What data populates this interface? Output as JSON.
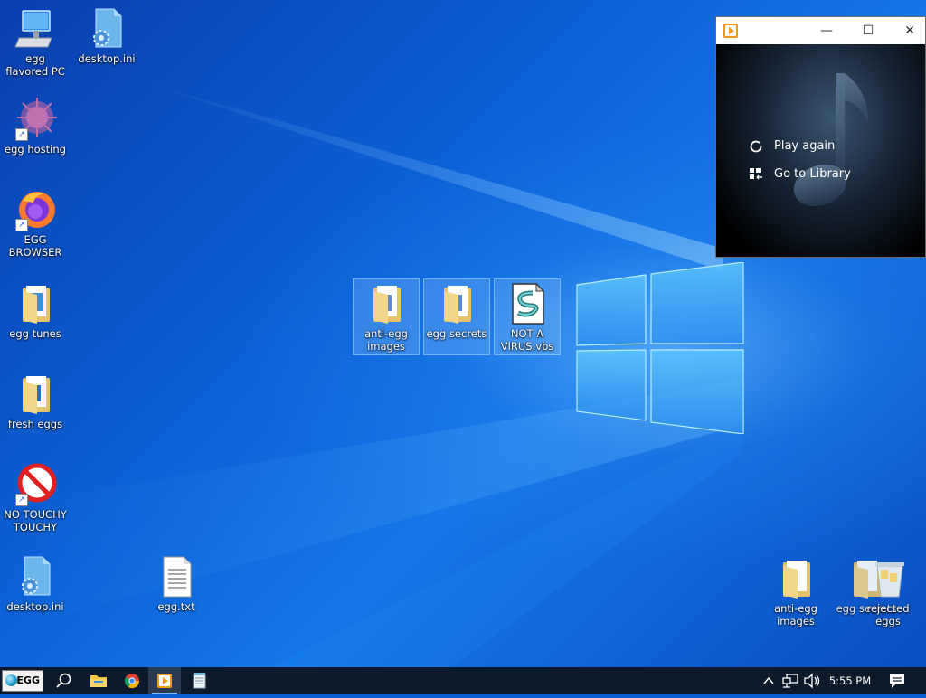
{
  "desktop": {
    "icons_left": [
      {
        "label": "egg flavored PC",
        "icon": "computer-icon"
      },
      {
        "label": "desktop.ini",
        "icon": "settings-file-icon"
      },
      {
        "label": "egg hosting",
        "icon": "globe-network-icon"
      },
      {
        "label": "EGG BROWSER",
        "icon": "firefox-icon"
      },
      {
        "label": "egg tunes",
        "icon": "folder-icon"
      },
      {
        "label": "fresh eggs",
        "icon": "folder-icon"
      },
      {
        "label": "NO TOUCHY TOUCHY",
        "icon": "prohibited-icon"
      },
      {
        "label": "desktop.ini",
        "icon": "settings-file-icon"
      },
      {
        "label": "egg.txt",
        "icon": "text-file-icon"
      }
    ],
    "icons_center_selected": [
      {
        "label": "anti-egg images",
        "icon": "folder-icon"
      },
      {
        "label": "egg secrets",
        "icon": "folder-icon"
      },
      {
        "label": "NOT A VIRUS.vbs",
        "icon": "vbscript-icon"
      }
    ],
    "icons_bottom_right": [
      {
        "label": "anti-egg images",
        "icon": "folder-icon"
      },
      {
        "label": "egg secrets",
        "icon": "folder-icon"
      },
      {
        "label": "rejected eggs",
        "icon": "recycle-bin-icon"
      }
    ]
  },
  "player": {
    "window_title": "",
    "app_icon": "media-player-icon",
    "controls": {
      "minimize": "—",
      "maximize": "☐",
      "close": "✕"
    },
    "menu": [
      {
        "label": "Play again",
        "icon": "replay-icon"
      },
      {
        "label": "Go to Library",
        "icon": "library-icon"
      }
    ]
  },
  "taskbar": {
    "start_label": "EGG",
    "pinned": [
      {
        "name": "search",
        "icon": "search-icon"
      },
      {
        "name": "file-explorer",
        "icon": "folder-icon"
      },
      {
        "name": "chrome",
        "icon": "chrome-icon"
      },
      {
        "name": "media-player",
        "icon": "media-player-icon",
        "active": true
      },
      {
        "name": "notepad",
        "icon": "notepad-icon"
      }
    ],
    "tray": {
      "icons": [
        "chevron-up-icon",
        "network-icon",
        "volume-icon"
      ],
      "time": "5:55 PM",
      "notification_icon": "action-center-icon"
    }
  },
  "colors": {
    "desktop_accent": "#0b63d8",
    "taskbar_bg": "#0d1a2b",
    "selection": "#96c8ff"
  }
}
